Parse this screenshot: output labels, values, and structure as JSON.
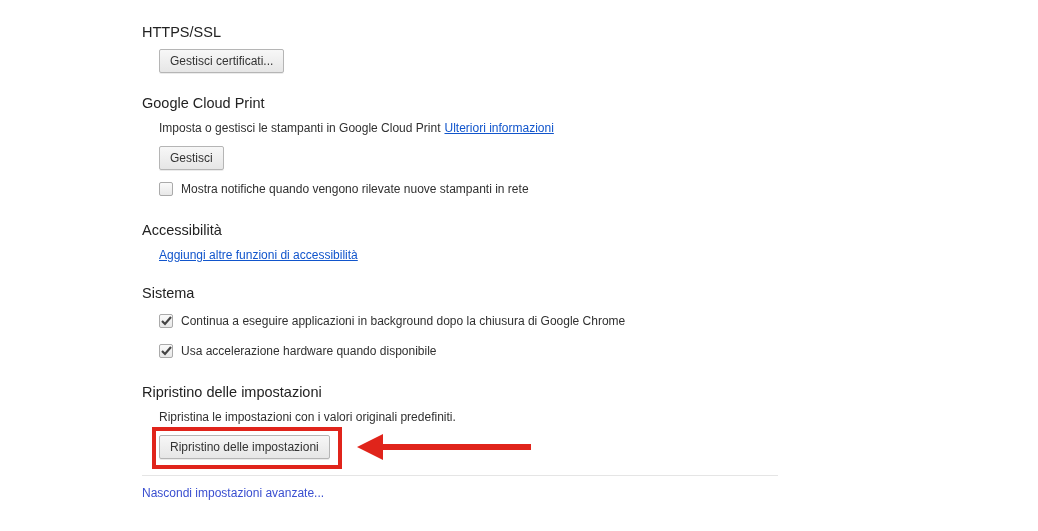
{
  "sections": [
    {
      "title": "HTTPS/SSL",
      "items": [
        {
          "kind": "button",
          "label": "Gestisci certificati..."
        }
      ]
    },
    {
      "title": "Google Cloud Print",
      "items": [
        {
          "kind": "text",
          "text": "Imposta o gestisci le stampanti in Google Cloud Print",
          "link": "Ulteriori informazioni"
        },
        {
          "kind": "button",
          "label": "Gestisci"
        },
        {
          "kind": "checkbox",
          "label": "Mostra notifiche quando vengono rilevate nuove stampanti in rete",
          "checked": false
        }
      ]
    },
    {
      "title": "Accessibilità",
      "items": [
        {
          "kind": "link",
          "label": "Aggiungi altre funzioni di accessibilità"
        }
      ]
    },
    {
      "title": "Sistema",
      "items": [
        {
          "kind": "checkbox",
          "label": "Continua a eseguire applicazioni in background dopo la chiusura di Google Chrome",
          "checked": true
        },
        {
          "kind": "checkbox",
          "label": "Usa accelerazione hardware quando disponibile",
          "checked": true
        }
      ]
    },
    {
      "title": "Ripristino delle impostazioni",
      "items": [
        {
          "kind": "text",
          "text": "Ripristina le impostazioni con i valori originali predefiniti."
        },
        {
          "kind": "button",
          "label": "Ripristino delle impostazioni",
          "highlighted": true
        }
      ]
    }
  ],
  "footer_link": "Nascondi impostazioni avanzate..."
}
